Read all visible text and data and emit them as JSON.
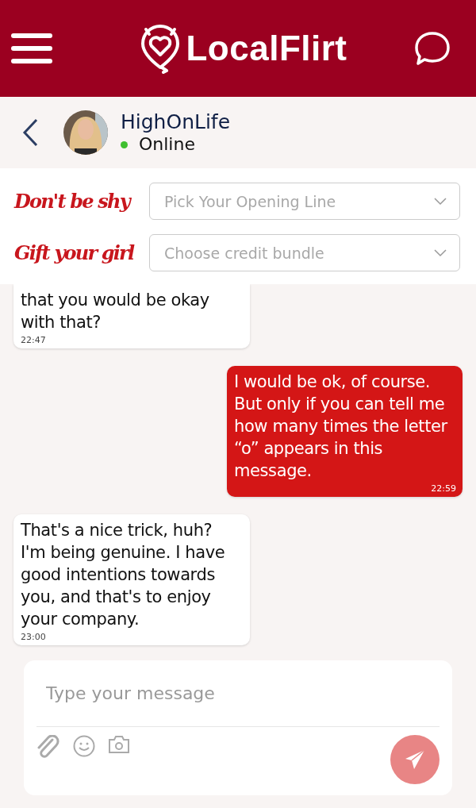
{
  "header": {
    "logo_text": "LocalFlirt"
  },
  "contact": {
    "name": "HighOnLife",
    "status": "Online",
    "online": true
  },
  "prompts": [
    {
      "label": "Don't be shy",
      "placeholder": "Pick Your Opening Line"
    },
    {
      "label": "Gift your girl",
      "placeholder": "Choose credit bundle"
    }
  ],
  "messages": [
    {
      "kind": "incoming",
      "text": "that you would be okay with that?",
      "time": "22:47"
    },
    {
      "kind": "outgoing",
      "text": "I would be ok, of course. But only if you can tell me how many times the letter “o” appears in this message.",
      "time": "22:59"
    },
    {
      "kind": "incoming",
      "text": "That's a nice trick, huh? I'm being genuine. I have good intentions towards you, and that's to enjoy your company.",
      "time": "23:00"
    }
  ],
  "composer": {
    "placeholder": "Type your message"
  }
}
